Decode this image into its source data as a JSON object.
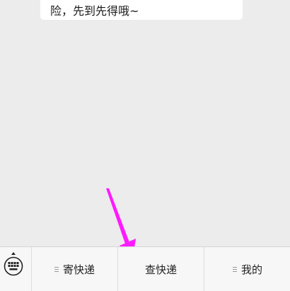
{
  "chat": {
    "message_text": "险，先到先得哦~"
  },
  "menu": {
    "items": [
      {
        "label": "寄快递",
        "has_submenu": true
      },
      {
        "label": "查快递",
        "has_submenu": false
      },
      {
        "label": "我的",
        "has_submenu": true
      }
    ]
  },
  "colors": {
    "background": "#ececec",
    "menu_bar": "#f7f7f7",
    "annotation_arrow": "#ff1aff"
  }
}
